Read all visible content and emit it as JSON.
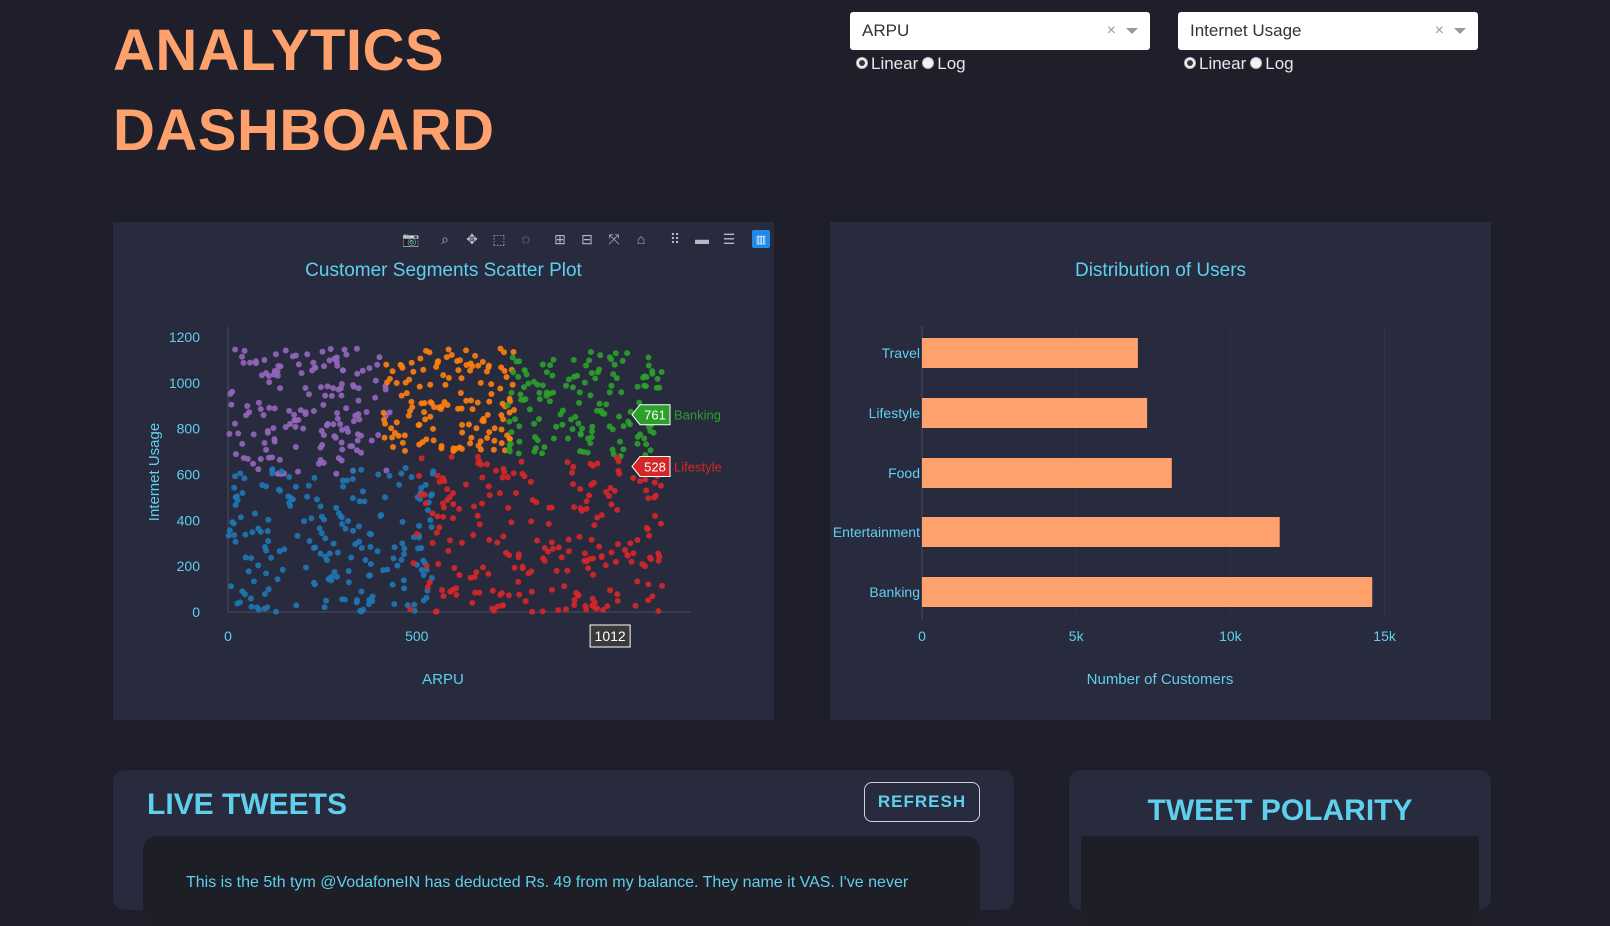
{
  "header": {
    "title_line1": "ANALYTICS",
    "title_line2": "DASHBOARD"
  },
  "controls": {
    "x_dropdown": {
      "value": "ARPU",
      "clear": "×"
    },
    "y_dropdown": {
      "value": "Internet Usage",
      "clear": "×"
    },
    "x_scale": {
      "options": [
        "Linear",
        "Log"
      ],
      "selected": "Linear"
    },
    "y_scale": {
      "options": [
        "Linear",
        "Log"
      ],
      "selected": "Linear"
    }
  },
  "modebar": {
    "icons": [
      "camera-icon",
      "zoom-icon",
      "pan-icon",
      "box-select-icon",
      "lasso-icon",
      "zoom-in-icon",
      "zoom-out-icon",
      "autoscale-icon",
      "reset-axes-icon",
      "spike-lines-icon",
      "hover-closest-icon",
      "hover-compare-icon",
      "plotly-logo-icon"
    ]
  },
  "scatter": {
    "title": "Customer Segments Scatter Plot",
    "xlabel": "ARPU",
    "ylabel": "Internet Usage",
    "hover_x": "1012",
    "hover_labels": [
      {
        "value": "761",
        "segment": "Banking",
        "color": "#2ca02c"
      },
      {
        "value": "528",
        "segment": "Lifestyle",
        "color": "#d62728"
      }
    ]
  },
  "bars": {
    "title": "Distribution of Users",
    "xlabel": "Number of Customers"
  },
  "chart_data": [
    {
      "type": "scatter",
      "title": "Customer Segments Scatter Plot",
      "xlabel": "ARPU",
      "ylabel": "Internet Usage",
      "xlim": [
        0,
        1220
      ],
      "ylim": [
        0,
        1200
      ],
      "x_ticks": [
        0,
        500
      ],
      "y_ticks": [
        0,
        200,
        400,
        600,
        800,
        1000,
        1200
      ],
      "series": [
        {
          "color": "#9467bd",
          "points_sample": 160,
          "region": {
            "x": [
              0,
              430
            ],
            "y": [
              600,
              1150
            ]
          }
        },
        {
          "color": "#ff7f0e",
          "points_sample": 140,
          "region": {
            "x": [
              410,
              760
            ],
            "y": [
              700,
              1150
            ]
          }
        },
        {
          "name": "Banking",
          "color": "#2ca02c",
          "points_sample": 150,
          "region": {
            "x": [
              740,
              1150
            ],
            "y": [
              680,
              1150
            ]
          }
        },
        {
          "color": "#1f77b4",
          "points_sample": 200,
          "region": {
            "x": [
              0,
              560
            ],
            "y": [
              0,
              640
            ]
          }
        },
        {
          "name": "Lifestyle",
          "color": "#d62728",
          "points_sample": 230,
          "region": {
            "x": [
              480,
              1150
            ],
            "y": [
              0,
              680
            ]
          }
        }
      ]
    },
    {
      "type": "bar",
      "orientation": "horizontal",
      "title": "Distribution of Users",
      "xlabel": "Number of Customers",
      "categories": [
        "Travel",
        "Lifestyle",
        "Food",
        "Entertainment",
        "Banking"
      ],
      "values": [
        7000,
        7300,
        8100,
        11600,
        14600
      ],
      "x_ticks": [
        0,
        5000,
        10000,
        15000
      ],
      "x_tick_labels": [
        "0",
        "5k",
        "10k",
        "15k"
      ],
      "color": "#ffa16c"
    }
  ],
  "tweets": {
    "title": "LIVE TWEETS",
    "refresh_label": "REFRESH",
    "first_tweet": "This is the 5th tym @VodafoneIN has deducted Rs. 49 from my balance. They name it VAS. I've never"
  },
  "polarity": {
    "title": "TWEET POLARITY"
  }
}
